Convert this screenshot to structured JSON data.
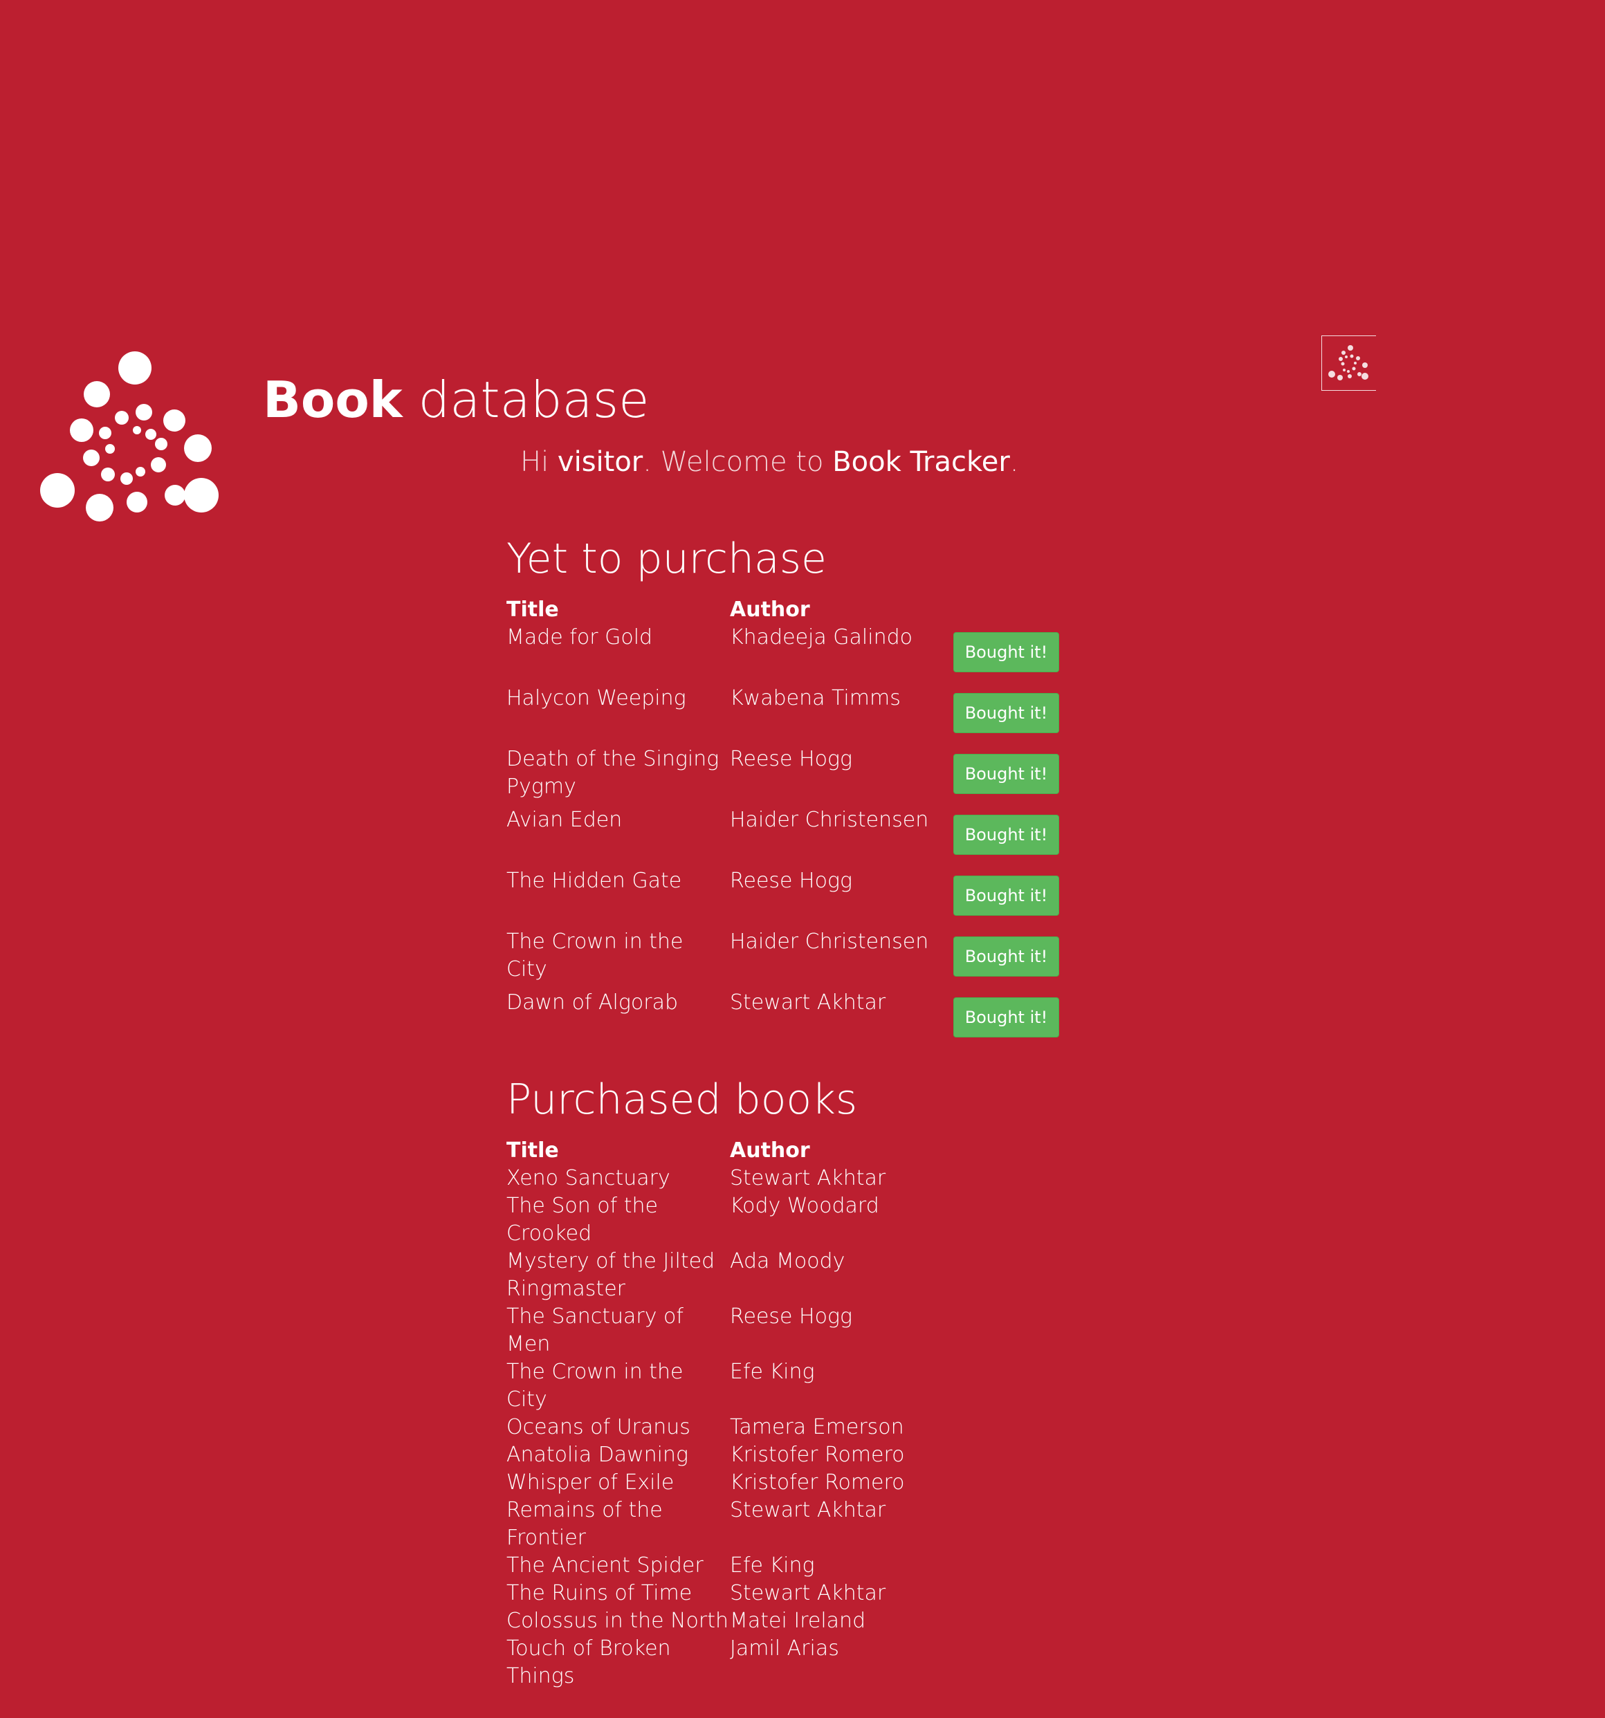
{
  "header": {
    "title_bold": "Book",
    "title_rest": " database"
  },
  "welcome": {
    "prefix": "Hi ",
    "user": "visitor",
    "middle": ". Welcome to ",
    "app": "Book Tracker",
    "suffix": "."
  },
  "to_purchase": {
    "heading": "Yet to purchase",
    "col_title": "Title",
    "col_author": "Author",
    "button_label": "Bought it!",
    "rows": [
      {
        "title": "Made for Gold",
        "author": "Khadeeja Galindo"
      },
      {
        "title": "Halycon Weeping",
        "author": "Kwabena Timms"
      },
      {
        "title": "Death of the Singing Pygmy",
        "author": "Reese Hogg"
      },
      {
        "title": "Avian Eden",
        "author": "Haider Christensen"
      },
      {
        "title": "The Hidden Gate",
        "author": "Reese Hogg"
      },
      {
        "title": "The Crown in the City",
        "author": "Haider Christensen"
      },
      {
        "title": "Dawn of Algorab",
        "author": "Stewart Akhtar"
      }
    ]
  },
  "purchased": {
    "heading": "Purchased books",
    "col_title": "Title",
    "col_author": "Author",
    "rows": [
      {
        "title": "Xeno Sanctuary",
        "author": "Stewart Akhtar"
      },
      {
        "title": "The Son of the Crooked",
        "author": "Kody Woodard"
      },
      {
        "title": "Mystery of the Jilted Ringmaster",
        "author": "Ada Moody"
      },
      {
        "title": "The Sanctuary of Men",
        "author": "Reese Hogg"
      },
      {
        "title": "The Crown in the City",
        "author": "Efe King"
      },
      {
        "title": "Oceans of Uranus",
        "author": "Tamera Emerson"
      },
      {
        "title": "Anatolia Dawning",
        "author": "Kristofer Romero"
      },
      {
        "title": "Whisper of Exile",
        "author": "Kristofer Romero"
      },
      {
        "title": "Remains of the Frontier",
        "author": "Stewart Akhtar"
      },
      {
        "title": "The Ancient Spider",
        "author": "Efe King"
      },
      {
        "title": "The Ruins of Time",
        "author": "Stewart Akhtar"
      },
      {
        "title": "Colossus in the North",
        "author": "Matei Ireland"
      },
      {
        "title": "Touch of Broken Things",
        "author": "Jamil Arias"
      }
    ]
  },
  "colors": {
    "background": "#bc1f30",
    "button": "#5cb85c",
    "text": "#ffffff"
  }
}
